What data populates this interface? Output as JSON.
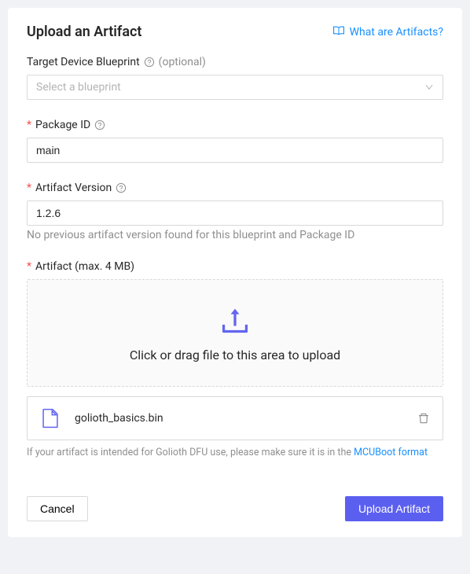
{
  "header": {
    "title": "Upload an Artifact",
    "help_link": "What are Artifacts?"
  },
  "fields": {
    "blueprint": {
      "label": "Target Device Blueprint",
      "optional": "(optional)",
      "placeholder": "Select a blueprint"
    },
    "package_id": {
      "label": "Package ID",
      "value": "main"
    },
    "artifact_version": {
      "label": "Artifact Version",
      "value": "1.2.6",
      "helper": "No previous artifact version found for this blueprint and Package ID"
    },
    "artifact_file": {
      "label": "Artifact (max. 4 MB)",
      "drop_text": "Click or drag file to this area to upload",
      "uploaded_file": "golioth_basics.bin",
      "hint_prefix": "If your artifact is intended for Golioth DFU use, please make sure it is in the ",
      "hint_link": "MCUBoot format"
    }
  },
  "buttons": {
    "cancel": "Cancel",
    "submit": "Upload Artifact"
  }
}
